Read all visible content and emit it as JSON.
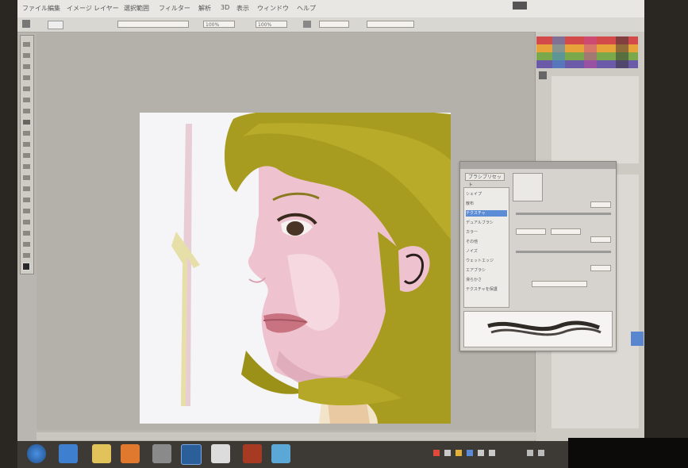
{
  "app": {
    "name": "Photoshop"
  },
  "menu": {
    "items": [
      "ファイル",
      "編集",
      "イメージ",
      "レイヤー",
      "選択範囲",
      "フィルター",
      "解析",
      "3D",
      "表示",
      "ウィンドウ",
      "ヘルプ"
    ]
  },
  "options_bar": {
    "opacity": "100%",
    "flow": "100%"
  },
  "brush_panel": {
    "preset_button": "ブラシプリセット",
    "rows": [
      "シェイプ",
      "散布",
      "テクスチャ",
      "デュアルブラシ",
      "カラー",
      "その他",
      "ノイズ",
      "ウェットエッジ",
      "エアブラシ",
      "滑らかさ",
      "テクスチャを保護"
    ]
  },
  "colors": {
    "accent": "#5d8cd6",
    "hair": "#a39a1e",
    "skin": "#ecc3cd",
    "lip": "#c7737e"
  },
  "taskbar": {
    "icons": [
      "start-icon",
      "ie-icon",
      "folder-icon",
      "media-icon",
      "app-icon",
      "photoshop-icon",
      "comic-icon",
      "red-app-icon",
      "network-icon"
    ]
  }
}
